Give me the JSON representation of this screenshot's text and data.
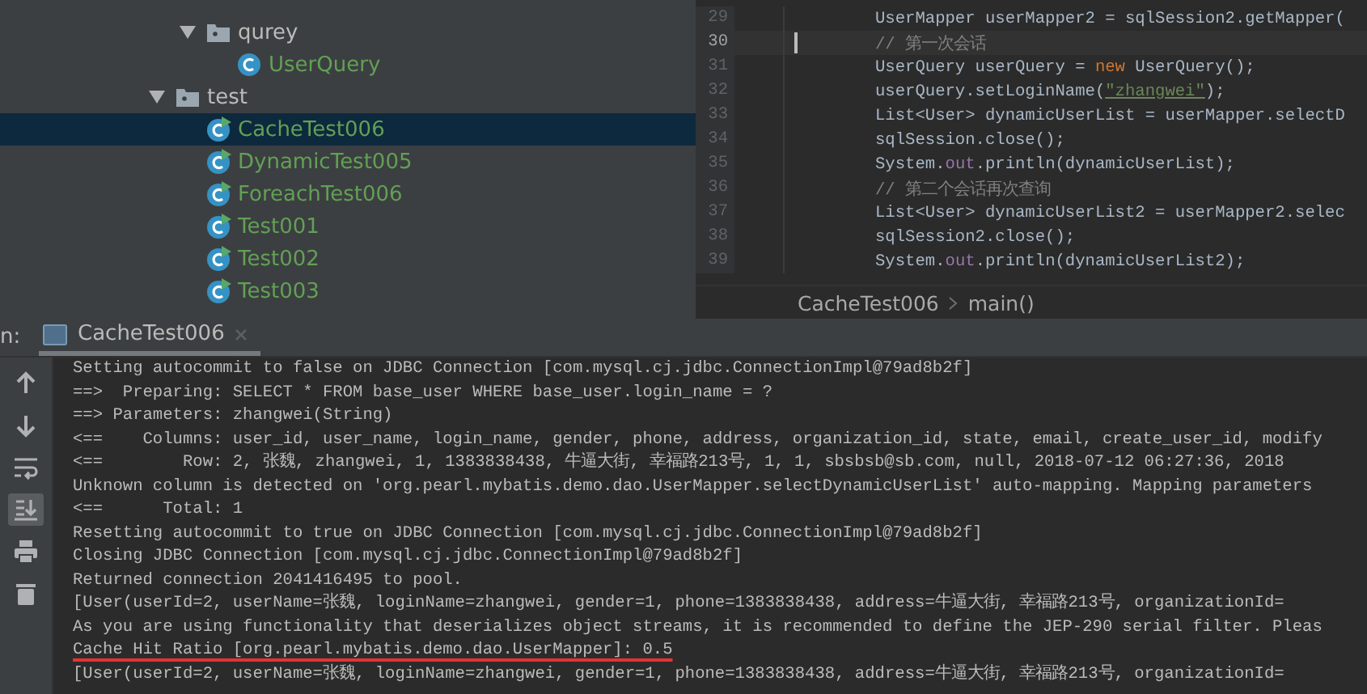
{
  "project_tree": {
    "partial_branch": [
      {
        "label": "qurey",
        "kind": "folder",
        "expanded": true,
        "selected": false,
        "children": [
          {
            "label": "UserQuery",
            "kind": "class",
            "selected": false
          }
        ]
      }
    ],
    "items": [
      {
        "label": "test",
        "kind": "folder",
        "expanded": true,
        "selected": false,
        "children": [
          {
            "label": "CacheTest006",
            "kind": "test-class",
            "selected": true
          },
          {
            "label": "DynamicTest005",
            "kind": "test-class",
            "selected": false
          },
          {
            "label": "ForeachTest006",
            "kind": "test-class",
            "selected": false
          },
          {
            "label": "Test001",
            "kind": "test-class",
            "selected": false
          },
          {
            "label": "Test002",
            "kind": "test-class",
            "selected": false
          },
          {
            "label": "Test003",
            "kind": "test-class",
            "selected": false
          }
        ]
      }
    ]
  },
  "editor": {
    "lines": [
      {
        "number": "29",
        "current": false,
        "tokens": [
          {
            "text": "UserMapper userMapper2 = sqlSession2.getMapper(",
            "kind": "plain"
          }
        ]
      },
      {
        "number": "30",
        "current": true,
        "tokens": [
          {
            "text": "// 第一次会话",
            "kind": "comment"
          }
        ]
      },
      {
        "number": "31",
        "current": false,
        "tokens": [
          {
            "text": "UserQuery userQuery = ",
            "kind": "plain"
          },
          {
            "text": "new",
            "kind": "keyword"
          },
          {
            "text": " UserQuery();",
            "kind": "plain"
          }
        ]
      },
      {
        "number": "32",
        "current": false,
        "tokens": [
          {
            "text": "userQuery.setLoginName(",
            "kind": "plain"
          },
          {
            "text": "\"zhangwei\"",
            "kind": "string"
          },
          {
            "text": ");",
            "kind": "plain"
          }
        ]
      },
      {
        "number": "33",
        "current": false,
        "tokens": [
          {
            "text": "List<User> dynamicUserList = userMapper.selectD",
            "kind": "plain"
          }
        ]
      },
      {
        "number": "34",
        "current": false,
        "tokens": [
          {
            "text": "sqlSession.close();",
            "kind": "plain"
          }
        ]
      },
      {
        "number": "35",
        "current": false,
        "tokens": [
          {
            "text": "System.",
            "kind": "plain"
          },
          {
            "text": "out",
            "kind": "field"
          },
          {
            "text": ".println(dynamicUserList);",
            "kind": "plain"
          }
        ]
      },
      {
        "number": "36",
        "current": false,
        "tokens": [
          {
            "text": "// 第二个会话再次查询",
            "kind": "comment"
          }
        ]
      },
      {
        "number": "37",
        "current": false,
        "tokens": [
          {
            "text": "List<User> dynamicUserList2 = userMapper2.selec",
            "kind": "plain"
          }
        ]
      },
      {
        "number": "38",
        "current": false,
        "tokens": [
          {
            "text": "sqlSession2.close();",
            "kind": "plain"
          }
        ]
      },
      {
        "number": "39",
        "current": false,
        "tokens": [
          {
            "text": "System.",
            "kind": "plain"
          },
          {
            "text": "out",
            "kind": "field"
          },
          {
            "text": ".println(dynamicUserList2);",
            "kind": "plain"
          }
        ]
      }
    ],
    "breadcrumb": [
      "CacheTest006",
      "main()"
    ]
  },
  "run_panel": {
    "label": "n:",
    "tab": {
      "title": "CacheTest006",
      "selected": true
    },
    "toolbar": [
      {
        "kind": "up",
        "selected": false
      },
      {
        "kind": "down",
        "selected": false
      },
      {
        "kind": "wrap",
        "selected": false
      },
      {
        "kind": "scroll-end",
        "selected": true
      },
      {
        "kind": "print",
        "selected": false
      },
      {
        "kind": "trash",
        "selected": false
      }
    ],
    "console": [
      {
        "text": "Setting autocommit to false on JDBC Connection [com.mysql.cj.jdbc.ConnectionImpl@79ad8b2f]",
        "underlined": false
      },
      {
        "text": "==>  Preparing: SELECT * FROM base_user WHERE base_user.login_name = ?",
        "underlined": false
      },
      {
        "text": "==> Parameters: zhangwei(String)",
        "underlined": false
      },
      {
        "text": "<==    Columns: user_id, user_name, login_name, gender, phone, address, organization_id, state, email, create_user_id, modify",
        "underlined": false
      },
      {
        "text": "<==        Row: 2, 张魏, zhangwei, 1, 1383838438, 牛逼大街, 幸福路213号, 1, 1, sbsbsb@sb.com, null, 2018-07-12 06:27:36, 2018",
        "underlined": false
      },
      {
        "text": "Unknown column is detected on 'org.pearl.mybatis.demo.dao.UserMapper.selectDynamicUserList' auto-mapping. Mapping parameters",
        "underlined": false
      },
      {
        "text": "<==      Total: 1",
        "underlined": false
      },
      {
        "text": "Resetting autocommit to true on JDBC Connection [com.mysql.cj.jdbc.ConnectionImpl@79ad8b2f]",
        "underlined": false
      },
      {
        "text": "Closing JDBC Connection [com.mysql.cj.jdbc.ConnectionImpl@79ad8b2f]",
        "underlined": false
      },
      {
        "text": "Returned connection 2041416495 to pool.",
        "underlined": false
      },
      {
        "text": "[User(userId=2, userName=张魏, loginName=zhangwei, gender=1, phone=1383838438, address=牛逼大街, 幸福路213号, organizationId=",
        "underlined": false
      },
      {
        "text": "As you are using functionality that deserializes object streams, it is recommended to define the JEP-290 serial filter. Pleas",
        "underlined": false
      },
      {
        "text": "Cache Hit Ratio [org.pearl.mybatis.demo.dao.UserMapper]: 0.5",
        "underlined": true
      },
      {
        "text": "[User(userId=2, userName=张魏, loginName=zhangwei, gender=1, phone=1383838438, address=牛逼大街, 幸福路213号, organizationId=",
        "underlined": false
      }
    ]
  }
}
